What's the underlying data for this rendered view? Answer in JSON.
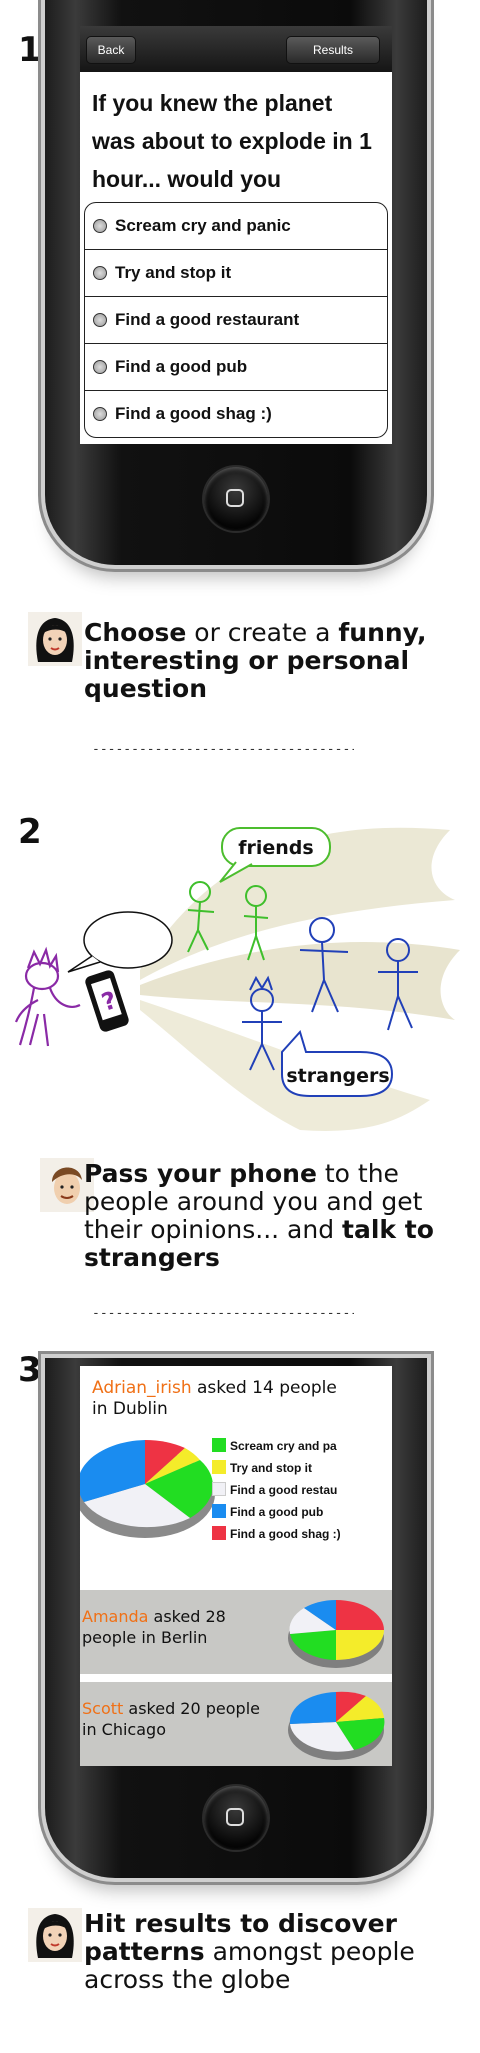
{
  "steps": [
    "1",
    "2",
    "3"
  ],
  "phone1": {
    "back_label": "Back",
    "results_label": "Results",
    "question": "If you knew the planet was about to explode in 1 hour... would you",
    "options": [
      "Scream cry and panic",
      "Try and stop it",
      "Find a good restaurant",
      "Find a good pub",
      "Find a good shag :)"
    ]
  },
  "caption1": {
    "p1": "Choose",
    "p2": " or create a ",
    "p3": "funny, interesting or personal question"
  },
  "separator": "--------------------------------------",
  "illustration": {
    "friends_label": "friends",
    "strangers_label": "strangers",
    "phone_symbol": "?"
  },
  "caption2": {
    "p1": "Pass your phone",
    "p2": " to the people around you and get their opinions... and ",
    "p3": "talk to strangers"
  },
  "phone3": {
    "main": {
      "user": "Adrian_irish",
      "text1": " asked 14 people",
      "text2": "in Dublin"
    },
    "legend": [
      {
        "label": "Scream cry and pa",
        "color": "#22dd22"
      },
      {
        "label": "Try and stop it",
        "color": "#f4ec2a"
      },
      {
        "label": "Find a good restau",
        "color": "#f1f1f6"
      },
      {
        "label": "Find a good pub",
        "color": "#1a8cf0"
      },
      {
        "label": "Find a good shag :)",
        "color": "#ee3344"
      }
    ],
    "result2": {
      "user": "Amanda",
      "text1": " asked 28",
      "text2": "people in Berlin"
    },
    "result3": {
      "user": "Scott",
      "text1": " asked 20 people",
      "text2": "in Chicago"
    }
  },
  "caption3": {
    "p1": "Hit results to discover patterns",
    "p2": " amongst people across the globe"
  }
}
